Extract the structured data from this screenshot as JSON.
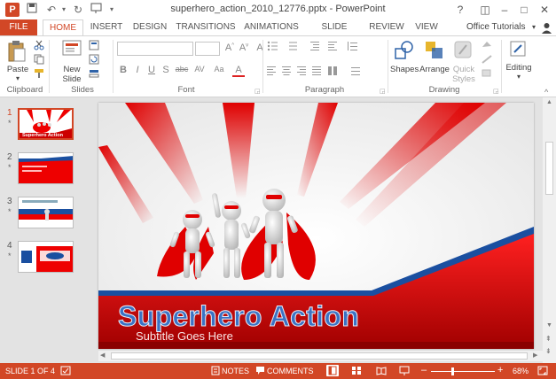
{
  "window": {
    "app_logo": "P",
    "title": "superhero_action_2010_12776.pptx - PowerPoint",
    "controls": [
      "?",
      "◫",
      "–",
      "□",
      "✕"
    ]
  },
  "tabs": [
    {
      "label": "FILE"
    },
    {
      "label": "HOME"
    },
    {
      "label": "INSERT"
    },
    {
      "label": "DESIGN"
    },
    {
      "label": "TRANSITIONS"
    },
    {
      "label": "ANIMATIONS"
    },
    {
      "label": "SLIDE SHOW"
    },
    {
      "label": "REVIEW"
    },
    {
      "label": "VIEW"
    }
  ],
  "account": "Office Tutorials",
  "ribbon": {
    "clipboard": {
      "paste": "Paste",
      "label": "Clipboard"
    },
    "slides": {
      "new_slide": "New",
      "new_slide2": "Slide",
      "label": "Slides"
    },
    "font": {
      "label": "Font",
      "buttons": [
        "B",
        "I",
        "U",
        "S",
        "abc",
        "AV",
        "Aa",
        "A"
      ]
    },
    "paragraph": {
      "label": "Paragraph"
    },
    "drawing": {
      "shapes": "Shapes",
      "arrange": "Arrange",
      "quick1": "Quick",
      "quick2": "Styles",
      "label": "Drawing"
    },
    "editing": {
      "label": "Editing"
    }
  },
  "thumbnails": [
    {
      "num": "1",
      "star": "*",
      "caption": "Superhero Action"
    },
    {
      "num": "2",
      "star": "*"
    },
    {
      "num": "3",
      "star": "*"
    },
    {
      "num": "4",
      "star": "*"
    }
  ],
  "slide": {
    "title": "Superhero Action",
    "subtitle": "Subtitle Goes Here"
  },
  "status": {
    "slide_info": "SLIDE 1 OF 4",
    "notes": "NOTES",
    "comments": "COMMENTS",
    "zoom_minus": "–",
    "zoom_plus": "+",
    "zoom": "68%",
    "zoom_level": 0.68
  },
  "colors": {
    "accent": "#d24726",
    "title_blue": "#3b73c4",
    "slide_red": "#e00000"
  }
}
